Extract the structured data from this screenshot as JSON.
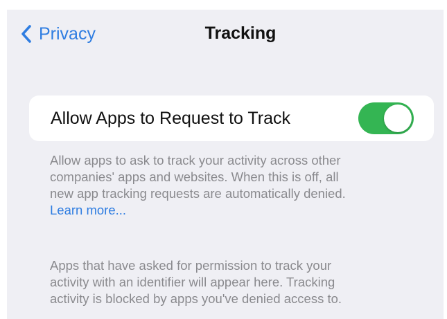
{
  "nav": {
    "back_label": "Privacy",
    "title": "Tracking"
  },
  "setting": {
    "label": "Allow Apps to Request to Track",
    "enabled": true
  },
  "description": {
    "line1": "Allow apps to ask to track your activity across other",
    "line2": "companies' apps and websites. When this is off, all",
    "line3": "new app tracking requests are automatically denied.",
    "learn_more": "Learn more..."
  },
  "empty_state": {
    "line1": "Apps that have asked for permission to track your",
    "line2": "activity with an identifier will appear here. Tracking",
    "line3": "activity is blocked by apps you've denied access to."
  },
  "colors": {
    "accent": "#2f7de1",
    "toggle_on": "#34b553",
    "background": "#efeff4"
  }
}
